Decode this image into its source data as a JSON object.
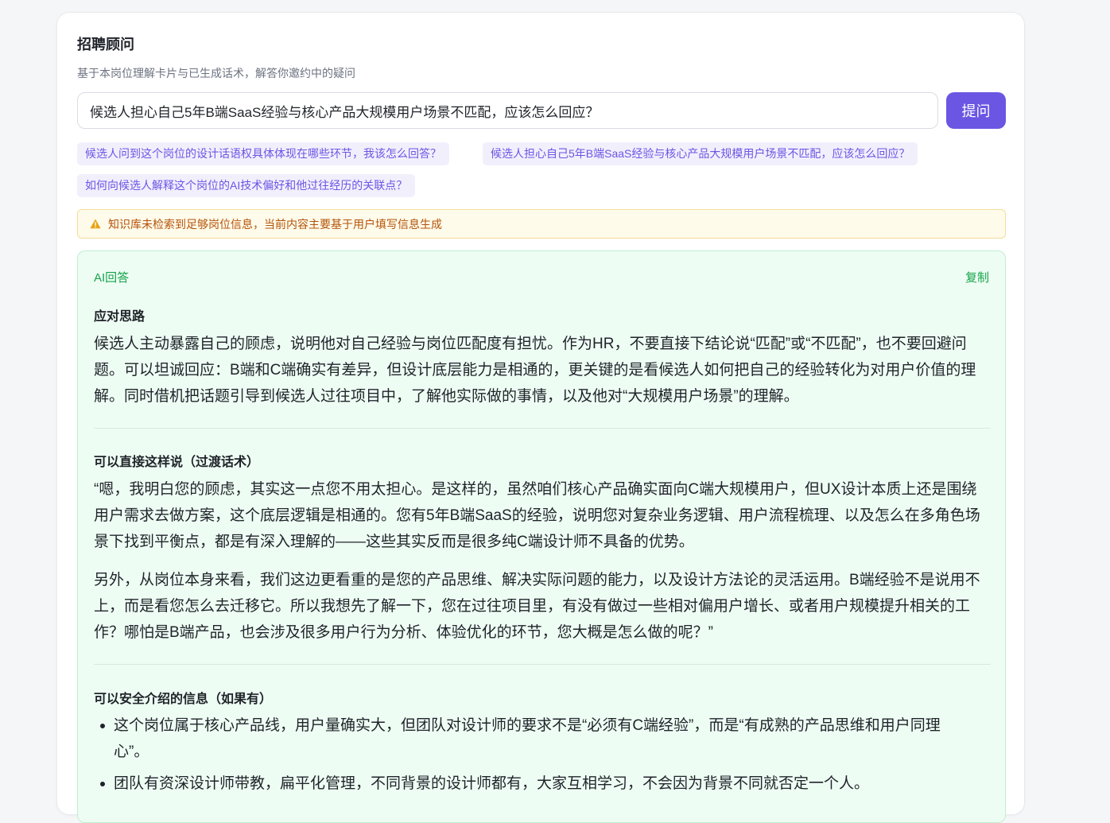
{
  "header": {
    "title": "招聘顾问",
    "subtitle": "基于本岗位理解卡片与已生成话术，解答你邀约中的疑问"
  },
  "ask": {
    "input_value": "候选人担心自己5年B端SaaS经验与核心产品大规模用户场景不匹配，应该怎么回应？",
    "button_label": "提问"
  },
  "suggestions": [
    "候选人问到这个岗位的设计话语权具体体现在哪些环节，我该怎么回答？",
    "候选人担心自己5年B端SaaS经验与核心产品大规模用户场景不匹配，应该怎么回应？",
    "如何向候选人解释这个岗位的AI技术偏好和他过往经历的关联点？"
  ],
  "warning": {
    "text": "知识库未检索到足够岗位信息，当前内容主要基于用户填写信息生成"
  },
  "answer": {
    "label": "AI回答",
    "copy_label": "复制",
    "section1_title": "应对思路",
    "section1_text": "候选人主动暴露自己的顾虑，说明他对自己经验与岗位匹配度有担忧。作为HR，不要直接下结论说“匹配”或“不匹配”，也不要回避问题。可以坦诚回应：B端和C端确实有差异，但设计底层能力是相通的，更关键的是看候选人如何把自己的经验转化为对用户价值的理解。同时借机把话题引导到候选人过往项目中，了解他实际做的事情，以及他对“大规模用户场景”的理解。",
    "section2_title": "可以直接这样说（过渡话术）",
    "section2_para1": "“嗯，我明白您的顾虑，其实这一点您不用太担心。是这样的，虽然咱们核心产品确实面向C端大规模用户，但UX设计本质上还是围绕用户需求去做方案，这个底层逻辑是相通的。您有5年B端SaaS的经验，说明您对复杂业务逻辑、用户流程梳理、以及怎么在多角色场景下找到平衡点，都是有深入理解的——这些其实反而是很多纯C端设计师不具备的优势。",
    "section2_para2": "另外，从岗位本身来看，我们这边更看重的是您的产品思维、解决实际问题的能力，以及设计方法论的灵活运用。B端经验不是说用不上，而是看您怎么去迁移它。所以我想先了解一下，您在过往项目里，有没有做过一些相对偏用户增长、或者用户规模提升相关的工作？哪怕是B端产品，也会涉及很多用户行为分析、体验优化的环节，您大概是怎么做的呢？”",
    "section3_title": "可以安全介绍的信息（如果有）",
    "section3_items": [
      "这个岗位属于核心产品线，用户量确实大，但团队对设计师的要求不是“必须有C端经验”，而是“有成熟的产品思维和用户同理心”。",
      "团队有资深设计师带教，扁平化管理，不同背景的设计师都有，大家互相学习，不会因为背景不同就否定一个人。"
    ]
  }
}
